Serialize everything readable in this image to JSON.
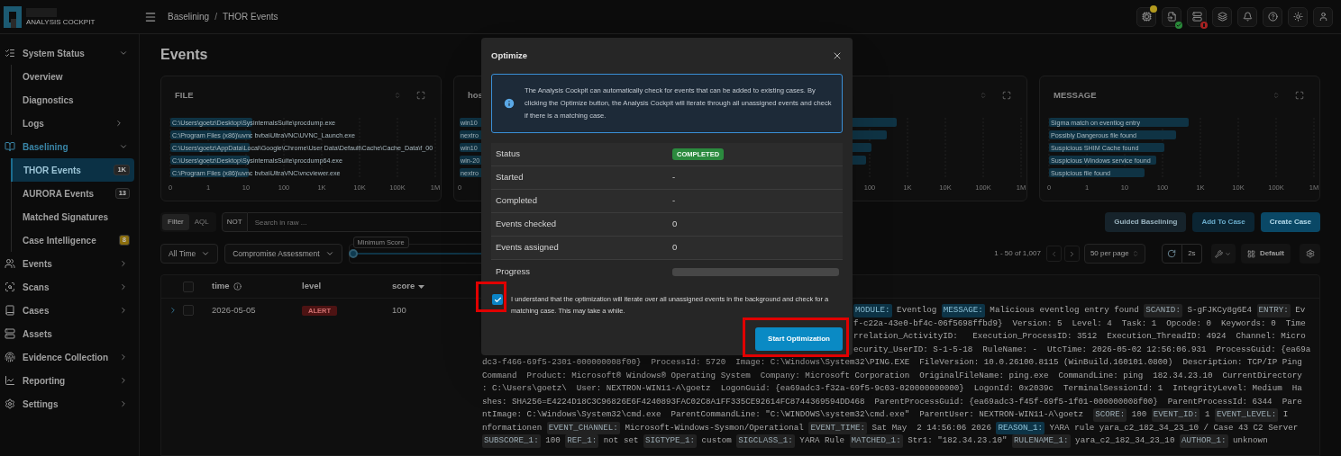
{
  "logo": {
    "text": "ANALYSIS COCKPIT"
  },
  "breadcrumb": {
    "separator": "/",
    "items": [
      "Baselining",
      "THOR Events"
    ]
  },
  "toolbar_badges": [
    {
      "color": "#b39a1e"
    },
    {
      "color": "#2a8a3a"
    },
    {
      "color": "#a52222"
    }
  ],
  "sidebar": {
    "items": [
      {
        "label": "System Status",
        "selected": false,
        "expandable": true,
        "expanded": true,
        "children": [
          {
            "label": "Overview",
            "selected": false,
            "expandable": false
          },
          {
            "label": "Diagnostics",
            "selected": false,
            "expandable": false
          },
          {
            "label": "Logs",
            "selected": false,
            "expandable": true
          }
        ]
      },
      {
        "label": "Baselining",
        "selected": true,
        "expandable": true,
        "expanded": true,
        "children": [
          {
            "label": "THOR Events",
            "selected": true,
            "expandable": false,
            "badge": "1K",
            "color": "#262626"
          },
          {
            "label": "AURORA Events",
            "selected": false,
            "expandable": false,
            "badge": "13",
            "color": "#161616"
          },
          {
            "label": "Matched Signatures",
            "selected": false,
            "expandable": false
          },
          {
            "label": "Case Intelligence",
            "selected": false,
            "expandable": false,
            "badge": "8",
            "color": "#8a6d0d"
          }
        ]
      },
      {
        "label": "Events",
        "selected": false,
        "expandable": true,
        "expanded": false
      },
      {
        "label": "Scans",
        "selected": false,
        "expandable": true,
        "expanded": false
      },
      {
        "label": "Cases",
        "selected": false,
        "expandable": true,
        "expanded": false
      },
      {
        "label": "Assets",
        "selected": false,
        "expandable": false
      },
      {
        "label": "Evidence Collection",
        "selected": false,
        "expandable": true,
        "expanded": false
      },
      {
        "label": "Reporting",
        "selected": false,
        "expandable": true,
        "expanded": false
      },
      {
        "label": "Settings",
        "selected": false,
        "expandable": true,
        "expanded": false
      }
    ]
  },
  "page_title": "Events",
  "cards": [
    {
      "kind": "full",
      "title": "FILE",
      "bar_labels": [
        "C:\\Users\\goetz\\Desktop\\SysinternalsSuite\\procdump.exe",
        "C:\\Program Files (x86)\\uvnc bvba\\UltraVNC\\UVNC_Launch.exe",
        "C:\\Users\\goetz\\AppData\\Local\\Google\\Chrome\\User Data\\Default\\Cache\\Cache_Data\\f_00",
        "C:\\Users\\goetz\\Desktop\\SysinternalsSuite\\procdump64.exe",
        "C:\\Program Files (x86)\\uvnc bvba\\UltraVNC\\vncviewer.exe"
      ],
      "axis_labels": [
        "0",
        "1",
        "10",
        "100",
        "1K",
        "10K",
        "100K",
        "1M"
      ]
    },
    {
      "kind": "left_visible",
      "title": "hos",
      "bar_labels": [
        "win10",
        "nextro",
        "win10",
        "win-20",
        "nextro"
      ],
      "axis_labels": [
        "0"
      ]
    },
    {
      "kind": "right_visible",
      "axis_labels": [
        "100",
        "1K",
        "10K",
        "100K",
        "1M"
      ]
    },
    {
      "kind": "full",
      "title": "MESSAGE",
      "bar_labels": [
        "Sigma match on eventlog entry",
        "Possibly Dangerous file found",
        "Suspicious SHIM Cache found",
        "Suspicious Windows service found",
        "Suspicious file found"
      ],
      "axis_labels": [
        "0",
        "1",
        "10",
        "100",
        "1K",
        "10K",
        "100K",
        "1M"
      ]
    }
  ],
  "filter": {
    "modes": [
      {
        "label": "Filter",
        "selected": true
      },
      {
        "label": "AQL",
        "selected": false
      }
    ],
    "not_label": "NOT",
    "search": {
      "placeholder": "Search in raw ..."
    },
    "actions": [
      {
        "label": "Guided Baselining",
        "kind": "secondary"
      },
      {
        "label": "Add To Case",
        "kind": "outline"
      },
      {
        "label": "Create Case",
        "kind": "primary"
      }
    ],
    "time_range": "All Time",
    "assessment": "Compromise Assessment",
    "min_score": {
      "label": "Minimum Score",
      "level": 0
    },
    "pagination": "1 - 50 of 1,007",
    "page_size": "50 per page",
    "refresh_interval": "2s",
    "view": "Default"
  },
  "table": {
    "select_all": {
      "checked": false
    },
    "columns": [
      {
        "label": "time",
        "info": true,
        "sorted": false
      },
      {
        "label": "level",
        "info": false,
        "sorted": false
      },
      {
        "label": "score",
        "info": false,
        "sorted": true
      }
    ],
    "rows": [
      {
        "expanded": false,
        "checked": false,
        "time": "2026-05-05",
        "level": "ALERT",
        "score": "100",
        "raw_lines": [
          {
            "indent": true,
            "segments": [
              {
                "kind": "key",
                "match": true,
                "text": "MODULE:"
              },
              {
                "kind": "value",
                "text": " Eventlog "
              },
              {
                "kind": "key",
                "match": true,
                "text": "MESSAGE:"
              },
              {
                "kind": "value",
                "text": " Malicious eventlog entry found "
              },
              {
                "kind": "key",
                "match": false,
                "text": "SCANID:"
              },
              {
                "kind": "value",
                "text": " S-gFJKCy8g6E4 "
              },
              {
                "kind": "key",
                "match": false,
                "text": "ENTRY:"
              },
              {
                "kind": "value",
                "text": " Ev"
              }
            ]
          },
          {
            "indent": true,
            "segments": [
              {
                "kind": "value",
                "text": "f-c22a-43e0-bf4c-06f5698ffbd9}  Version: 5  Level: 4  Task: 1  Opcode: 0  Keywords: 0  Time"
              }
            ]
          },
          {
            "indent": true,
            "segments": [
              {
                "kind": "value",
                "text": "rrelation_ActivityID:   Execution_ProcessID: 3512  Execution_ThreadID: 4924  Channel: Micro"
              }
            ]
          },
          {
            "indent": true,
            "segments": [
              {
                "kind": "value",
                "text": "ecurity_UserID: S-1-5-18  RuleName: -  UtcTime: 2026-05-02 12:56:06.931  ProcessGuid: {ea69a"
              }
            ]
          },
          {
            "indent": false,
            "segments": [
              {
                "kind": "value",
                "text": "dc3-f466-69f5-2301-000000008f00}  ProcessId: 5720  Image: C:\\Windows\\System32\\PING.EXE  FileVersion: 10.0.26100.8115 (WinBuild.160101.0800)  Description: TCP/IP Ping"
              }
            ]
          },
          {
            "indent": false,
            "segments": [
              {
                "kind": "value",
                "text": "Command  Product: Microsoft® Windows® Operating System  Company: Microsoft Corporation  OriginalFileName: ping.exe  CommandLine: ping  182.34.23.10  CurrentDirectory"
              }
            ]
          },
          {
            "indent": false,
            "segments": [
              {
                "kind": "value",
                "text": ": C:\\Users\\goetz\\  User: NEXTRON-WIN11-A\\goetz  LogonGuid: {ea69adc3-f32a-69f5-9c03-020000000000}  LogonId: 0x2039c  TerminalSessionId: 1  IntegrityLevel: Medium  Ha"
              }
            ]
          },
          {
            "indent": false,
            "segments": [
              {
                "kind": "value",
                "text": "shes: SHA256=E4224D18C3C96826E6F4240893FAC02C8A1FF335CE92614FC8744369594DD468  ParentProcessGuid: {ea69adc3-f45f-69f5-1f01-000000008f00}  ParentProcessId: 6344  Pare"
              }
            ]
          },
          {
            "indent": false,
            "segments": [
              {
                "kind": "value",
                "text": "ntImage: C:\\Windows\\System32\\cmd.exe  ParentCommandLine: \"C:\\WINDOWS\\system32\\cmd.exe\"  ParentUser: NEXTRON-WIN11-A\\goetz  "
              },
              {
                "kind": "key",
                "match": false,
                "text": "SCORE:"
              },
              {
                "kind": "value",
                "text": " 100 "
              },
              {
                "kind": "key",
                "match": false,
                "text": "EVENT_ID:"
              },
              {
                "kind": "value",
                "text": " 1 "
              },
              {
                "kind": "key",
                "match": false,
                "text": "EVENT_LEVEL:"
              },
              {
                "kind": "value",
                "text": " I"
              }
            ]
          },
          {
            "indent": false,
            "segments": [
              {
                "kind": "value",
                "text": "nformationen "
              },
              {
                "kind": "key",
                "match": false,
                "text": "EVENT_CHANNEL:"
              },
              {
                "kind": "value",
                "text": " Microsoft-Windows-Sysmon/Operational "
              },
              {
                "kind": "key",
                "match": false,
                "text": "EVENT_TIME:"
              },
              {
                "kind": "value",
                "text": " Sat May  2 14:56:06 2026 "
              },
              {
                "kind": "key",
                "match": true,
                "text": "REASON_1:"
              },
              {
                "kind": "value",
                "text": " YARA rule yara_c2_182_34_23_10 / Case 43 C2 Server"
              }
            ]
          },
          {
            "segments": [
              {
                "kind": "key",
                "match": false,
                "text": "SUBSCORE_1:"
              },
              {
                "kind": "value",
                "text": " 100 "
              },
              {
                "kind": "key",
                "match": false,
                "text": "REF_1:"
              },
              {
                "kind": "value",
                "text": " not set "
              },
              {
                "kind": "key",
                "match": false,
                "text": "SIGTYPE_1:"
              },
              {
                "kind": "value",
                "text": " custom "
              },
              {
                "kind": "key",
                "match": false,
                "text": "SIGCLASS_1:"
              },
              {
                "kind": "value",
                "text": " YARA Rule "
              },
              {
                "kind": "key",
                "match": false,
                "text": "MATCHED_1:"
              },
              {
                "kind": "value",
                "text": " Str1: \"182.34.23.10\" "
              },
              {
                "kind": "key",
                "match": false,
                "text": "RULENAME_1:"
              },
              {
                "kind": "value",
                "text": " yara_c2_182_34_23_10 "
              },
              {
                "kind": "key",
                "match": false,
                "text": "AUTHOR_1:"
              },
              {
                "kind": "value",
                "text": " unknown"
              }
            ]
          }
        ]
      }
    ]
  },
  "modal": {
    "title": "Optimize",
    "info": "The Analysis Cockpit can automatically check for events that can be added to existing cases. By clicking the Optimize button, the Analysis Cockpit will iterate through all unassigned events and check if there is a matching case.",
    "rows": [
      {
        "label": "Status",
        "kind": "badge",
        "value": "COMPLETED"
      },
      {
        "label": "Started",
        "kind": "text",
        "value": "-"
      },
      {
        "label": "Completed",
        "kind": "text",
        "value": "-"
      },
      {
        "label": "Events checked",
        "kind": "text",
        "value": "0"
      },
      {
        "label": "Events assigned",
        "kind": "text",
        "value": "0"
      },
      {
        "label": "Progress",
        "kind": "progress",
        "level": 0
      }
    ],
    "consent": {
      "text": "I understand that the optimization will iterate over all unassigned events in the background and check for a matching case. This may take a while.",
      "checked": true,
      "highlighted": true
    },
    "start_button": {
      "label": "Start Optimization",
      "highlighted": true
    }
  }
}
